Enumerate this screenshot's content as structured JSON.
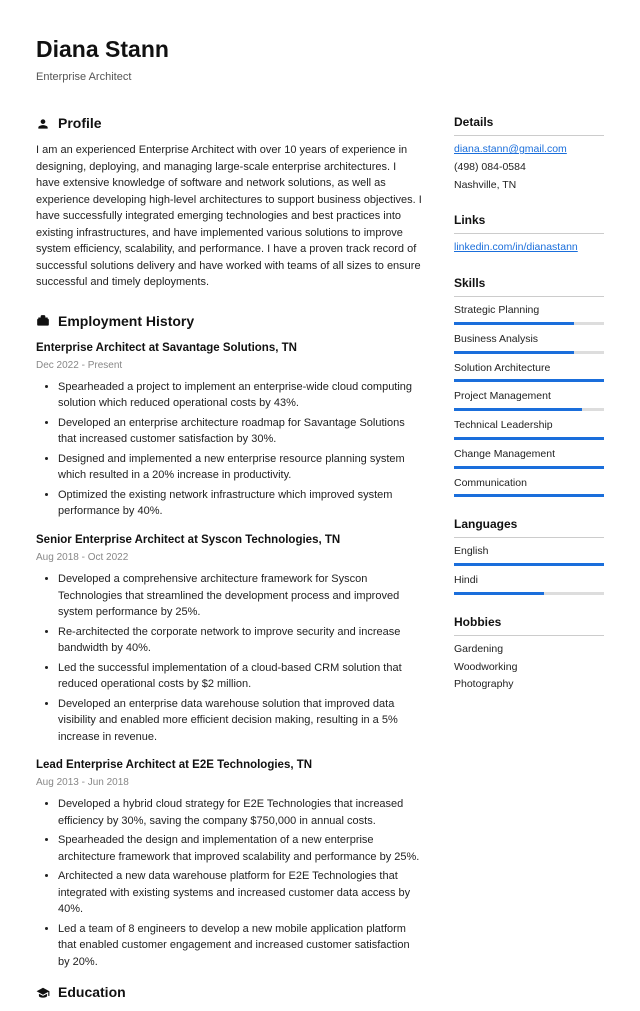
{
  "header": {
    "name": "Diana Stann",
    "subtitle": "Enterprise Architect"
  },
  "profile": {
    "heading": "Profile",
    "text": "I am an experienced Enterprise Architect with over 10 years of experience in designing, deploying, and managing large-scale enterprise architectures. I have extensive knowledge of software and network solutions, as well as experience developing high-level architectures to support business objectives. I have successfully integrated emerging technologies and best practices into existing infrastructures, and have implemented various solutions to improve system efficiency, scalability, and performance. I have a proven track record of successful solutions delivery and have worked with teams of all sizes to ensure successful and timely deployments."
  },
  "employment": {
    "heading": "Employment History",
    "jobs": [
      {
        "title": "Enterprise Architect at Savantage Solutions, TN",
        "dates": "Dec 2022 - Present",
        "bullets": [
          "Spearheaded a project to implement an enterprise-wide cloud computing solution which reduced operational costs by 43%.",
          "Developed an enterprise architecture roadmap for Savantage Solutions that increased customer satisfaction by 30%.",
          "Designed and implemented a new enterprise resource planning system which resulted in a 20% increase in productivity.",
          "Optimized the existing network infrastructure which improved system performance by 40%."
        ]
      },
      {
        "title": "Senior Enterprise Architect at Syscon Technologies, TN",
        "dates": "Aug 2018 - Oct 2022",
        "bullets": [
          "Developed a comprehensive architecture framework for Syscon Technologies that streamlined the development process and improved system performance by 25%.",
          "Re-architected the corporate network to improve security and increase bandwidth by 40%.",
          "Led the successful implementation of a cloud-based CRM solution that reduced operational costs by $2 million.",
          "Developed an enterprise data warehouse solution that improved data visibility and enabled more efficient decision making, resulting in a 5% increase in revenue."
        ]
      },
      {
        "title": "Lead Enterprise Architect at E2E Technologies, TN",
        "dates": "Aug 2013 - Jun 2018",
        "bullets": [
          "Developed a hybrid cloud strategy for E2E Technologies that increased efficiency by 30%, saving the company $750,000 in annual costs.",
          "Spearheaded the design and implementation of a new enterprise architecture framework that improved scalability and performance by 25%.",
          "Architected a new data warehouse platform for E2E Technologies that integrated with existing systems and increased customer data access by 40%.",
          "Led a team of 8 engineers to develop a new mobile application platform that enabled customer engagement and increased customer satisfaction by 20%."
        ]
      }
    ]
  },
  "education": {
    "heading": "Education"
  },
  "details": {
    "heading": "Details",
    "email": "diana.stann@gmail.com",
    "phone": "(498) 084-0584",
    "location": "Nashville, TN"
  },
  "links": {
    "heading": "Links",
    "items": [
      "linkedin.com/in/dianastann"
    ]
  },
  "skills": {
    "heading": "Skills",
    "items": [
      {
        "name": "Strategic Planning",
        "pct": 80
      },
      {
        "name": "Business Analysis",
        "pct": 80
      },
      {
        "name": "Solution Architecture",
        "pct": 100
      },
      {
        "name": "Project Management",
        "pct": 85
      },
      {
        "name": "Technical Leadership",
        "pct": 100
      },
      {
        "name": "Change Management",
        "pct": 100
      },
      {
        "name": "Communication",
        "pct": 100
      }
    ]
  },
  "languages": {
    "heading": "Languages",
    "items": [
      {
        "name": "English",
        "pct": 100
      },
      {
        "name": "Hindi",
        "pct": 60
      }
    ]
  },
  "hobbies": {
    "heading": "Hobbies",
    "items": [
      "Gardening",
      "Woodworking",
      "Photography"
    ]
  }
}
